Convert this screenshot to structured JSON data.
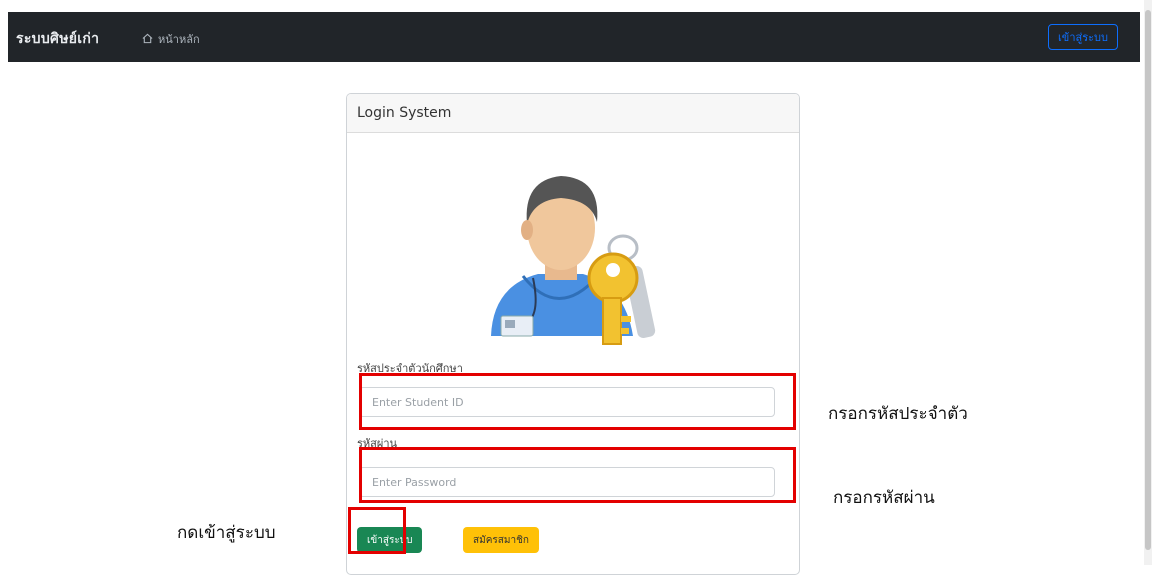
{
  "navbar": {
    "brand": "ระบบศิษย์เก่า",
    "home_label": "หน้าหลัก",
    "login_button": "เข้าสู่ระบบ"
  },
  "card": {
    "title": "Login System",
    "student_id_label": "รหัสประจำตัวนักศึกษา",
    "student_id_placeholder": "Enter Student ID",
    "password_label": "รหัสผ่าน",
    "password_placeholder": "Enter Password",
    "login_button": "เข้าสู่ระบบ",
    "register_button": "สมัครสมาชิก"
  },
  "annotations": {
    "student_id_note": "กรอกรหัสประจำตัว",
    "password_note": "กรอกรหัสผ่าน",
    "login_note": "กดเข้าสู่ระบบ"
  },
  "colors": {
    "navbar": "#212529",
    "login_green": "#198754",
    "register_yellow": "#ffc107",
    "highlight_red": "#e30000",
    "outline_blue": "#0d6efd"
  },
  "icons": {
    "home": "home-icon",
    "avatar": "user-key-illustration"
  }
}
